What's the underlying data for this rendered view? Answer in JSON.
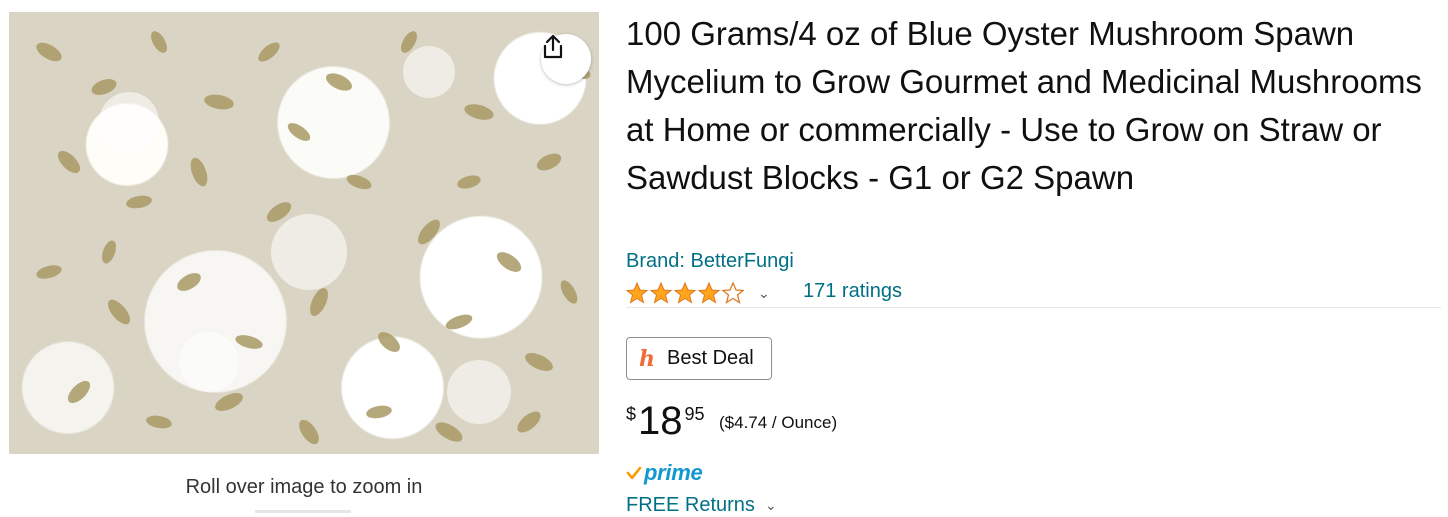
{
  "product": {
    "title": "100 Grams/4 oz of Blue Oyster Mushroom Spawn Mycelium to Grow Gourmet and Medicinal Mushrooms at Home or commercially - Use to Grow on Straw or Sawdust Blocks - G1 or G2 Spawn",
    "brand_link": "Brand: BetterFungi",
    "rating": {
      "stars": 4,
      "max": 5,
      "ratings_link": "171 ratings"
    },
    "deal_badge": "Best Deal",
    "price": {
      "symbol": "$",
      "whole": "18",
      "fraction": "95",
      "unit_price": "($4.74 / Ounce)"
    },
    "prime_label": "prime",
    "returns_label": "FREE Returns"
  },
  "image": {
    "zoom_hint": "Roll over image to zoom in",
    "share_icon": "share-icon"
  },
  "colors": {
    "link": "#007185",
    "star": "#ffa41c",
    "prime": "#1399cf",
    "prime_check": "#ff9900",
    "deal_icon": "#ef6b3a"
  }
}
